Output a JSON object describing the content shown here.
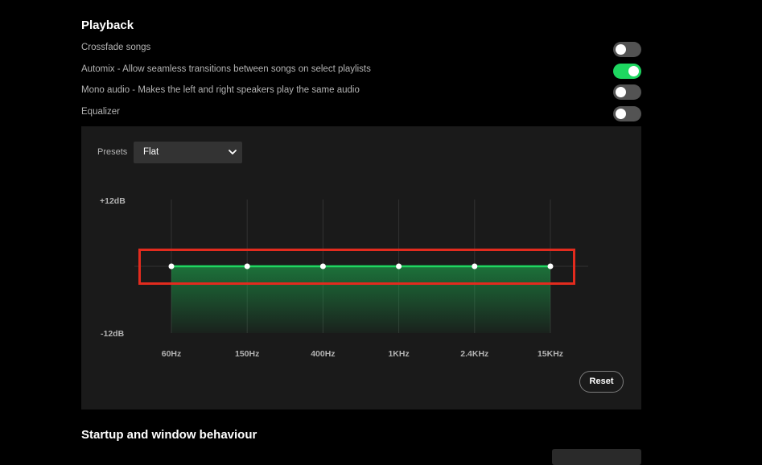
{
  "playback": {
    "title": "Playback",
    "settings": [
      {
        "label": "Crossfade songs",
        "enabled": false
      },
      {
        "label": "Automix - Allow seamless transitions between songs on select playlists",
        "enabled": true
      },
      {
        "label": "Mono audio - Makes the left and right speakers play the same audio",
        "enabled": false
      },
      {
        "label": "Equalizer",
        "enabled": false
      }
    ]
  },
  "equalizer": {
    "presets_label": "Presets",
    "preset_value": "Flat",
    "db_max_label": "+12dB",
    "db_min_label": "-12dB",
    "db_range": [
      -12,
      12
    ],
    "bands": [
      {
        "freq": "60Hz",
        "gain_db": 0
      },
      {
        "freq": "150Hz",
        "gain_db": 0
      },
      {
        "freq": "400Hz",
        "gain_db": 0
      },
      {
        "freq": "1KHz",
        "gain_db": 0
      },
      {
        "freq": "2.4KHz",
        "gain_db": 0
      },
      {
        "freq": "15KHz",
        "gain_db": 0
      }
    ],
    "reset_label": "Reset",
    "colors": {
      "line": "#1ed760",
      "fill": "#1db954",
      "highlight": "#e22b1e"
    }
  },
  "startup": {
    "title": "Startup and window behaviour"
  },
  "icons": {
    "preset_dropdown": "chevron-down-icon"
  }
}
